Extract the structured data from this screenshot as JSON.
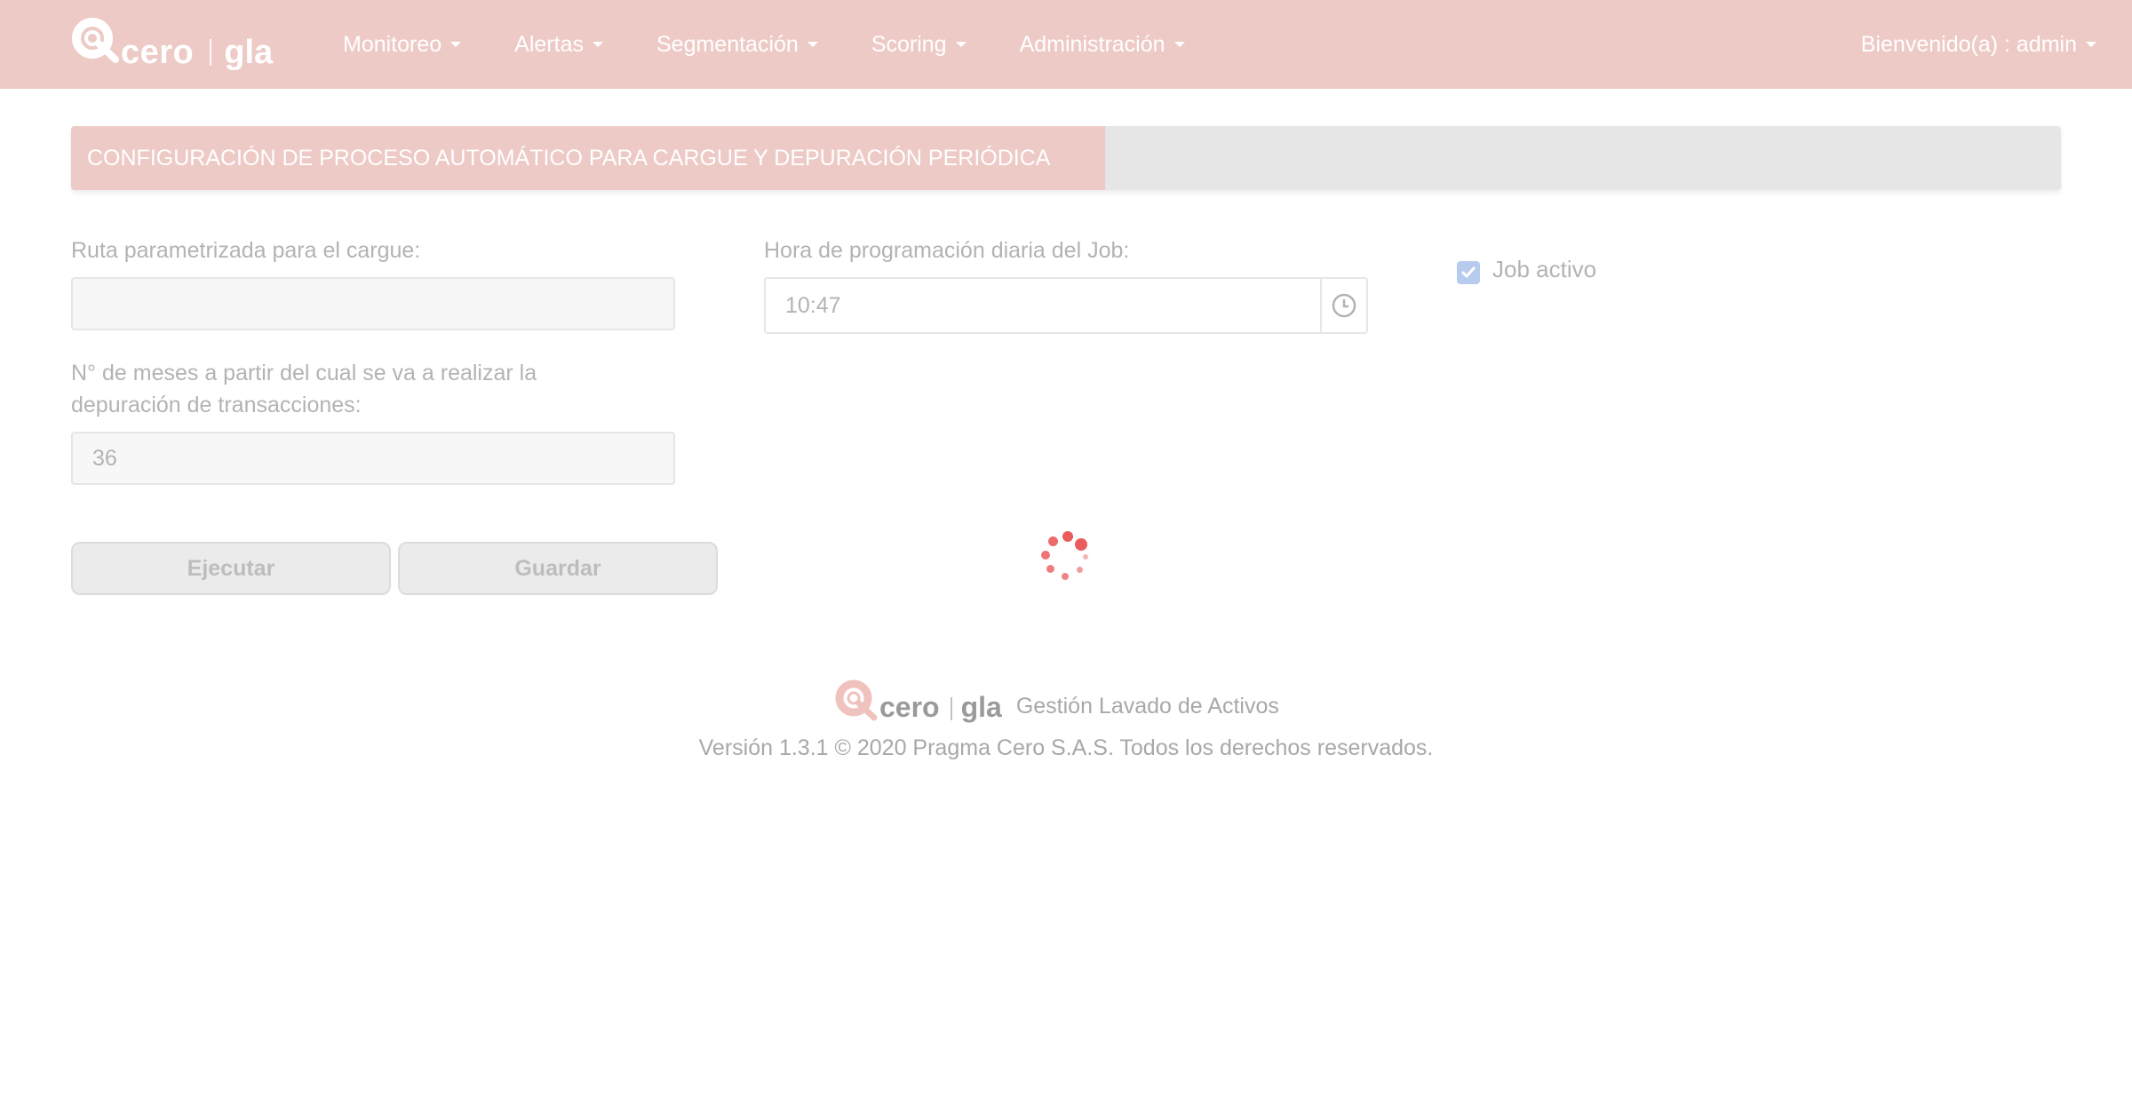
{
  "brand": {
    "name_main": "cero",
    "name_product": "gla"
  },
  "nav": {
    "items": [
      {
        "label": "Monitoreo"
      },
      {
        "label": "Alertas"
      },
      {
        "label": "Segmentación"
      },
      {
        "label": "Scoring"
      },
      {
        "label": "Administración"
      }
    ],
    "user_label": "Bienvenido(a) : admin"
  },
  "section": {
    "title": "CONFIGURACIÓN DE PROCESO AUTOMÁTICO PARA CARGUE Y DEPURACIÓN PERIÓDICA"
  },
  "form": {
    "route_label": "Ruta parametrizada para el cargue:",
    "route_value": "",
    "schedule_label": "Hora de programación diaria del Job:",
    "schedule_value": "10:47",
    "months_label_line1": "N° de meses a partir del cual se va a realizar la",
    "months_label_line2": "depuración de transacciones:",
    "months_value": "36",
    "job_active_label": "Job activo",
    "job_active_checked": true
  },
  "buttons": {
    "execute": "Ejecutar",
    "save": "Guardar"
  },
  "footer": {
    "logo_main": "cero",
    "logo_product": "gla",
    "tagline": "Gestión Lavado de Activos",
    "copyright": "Versión 1.3.1 © 2020 Pragma Cero S.A.S. Todos los derechos reservados."
  },
  "colors": {
    "navbar": "#edcac6",
    "spinner": "#ea5c5c",
    "checkbox": "#b7cbef"
  }
}
